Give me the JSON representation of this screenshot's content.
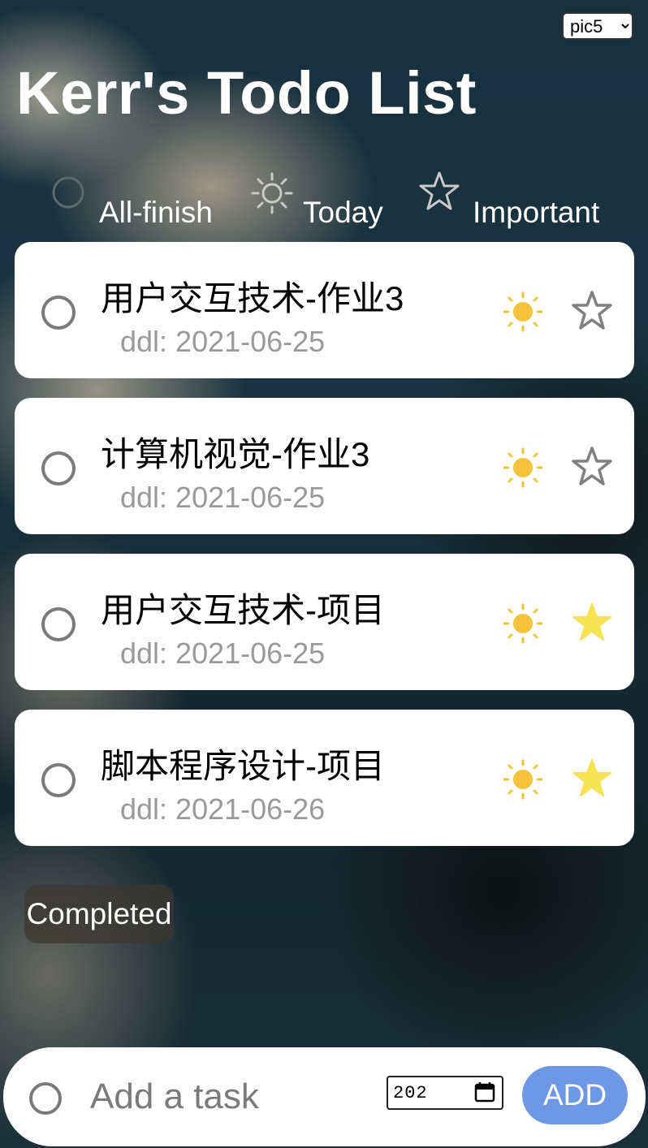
{
  "app": {
    "title": "Kerr's Todo List",
    "background_select": {
      "selected": "pic5"
    }
  },
  "filters": [
    {
      "label": "All-finish",
      "icon": "circle-icon"
    },
    {
      "label": "Today",
      "icon": "sun-icon"
    },
    {
      "label": "Important",
      "icon": "star-outline-icon"
    }
  ],
  "tasks": [
    {
      "title": "用户交互技术-作业3",
      "ddl": "ddl: 2021-06-25",
      "today": true,
      "important": false
    },
    {
      "title": "计算机视觉-作业3",
      "ddl": "ddl: 2021-06-25",
      "today": true,
      "important": false
    },
    {
      "title": "用户交互技术-项目",
      "ddl": "ddl: 2021-06-25",
      "today": true,
      "important": true
    },
    {
      "title": "脚本程序设计-项目",
      "ddl": "ddl: 2021-06-26",
      "today": true,
      "important": true
    }
  ],
  "completed_label": "Completed",
  "add_bar": {
    "placeholder": "Add a task",
    "date_value": "202",
    "add_label": "ADD"
  },
  "colors": {
    "sun": "#f3c13a",
    "star_active": "#f5e353",
    "star_inactive": "#808080",
    "add_button": "#6f98e4"
  }
}
